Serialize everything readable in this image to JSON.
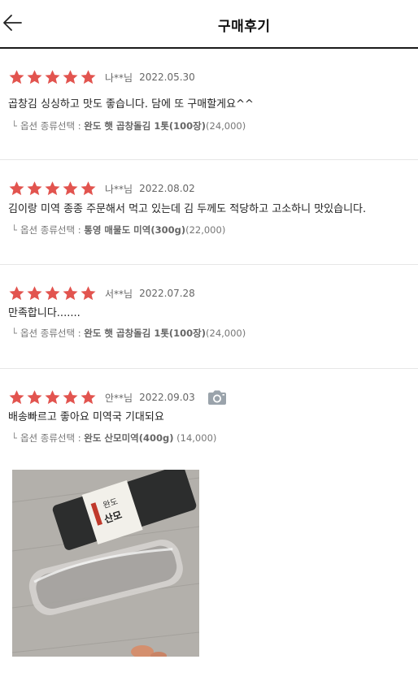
{
  "header": {
    "title": "구매후기"
  },
  "colors": {
    "star": "#e2544f",
    "camera": "#9aa3ab"
  },
  "option_label": "옵션 종류선택 : ",
  "reviews": [
    {
      "rating": 5,
      "user": "나**님",
      "date": "2022.05.30",
      "content": "곱창김 싱싱하고 맛도 좋습니다. 담에 또 구매할게요^^",
      "option_name": "완도 햇 곱창돌김 1톳(100장)",
      "option_price": "(24,000)",
      "has_photo": false
    },
    {
      "rating": 5,
      "user": "나**님",
      "date": "2022.08.02",
      "content": "김이랑 미역 종종 주문해서 먹고 있는데 김 두께도 적당하고 고소하니 맛있습니다.",
      "option_name": "통영 매물도 미역(300g)",
      "option_price": "(22,000)",
      "has_photo": false
    },
    {
      "rating": 5,
      "user": "서**님",
      "date": "2022.07.28",
      "content": "만족합니다.......",
      "option_name": "완도 햇 곱창돌김 1톳(100장)",
      "option_price": "(24,000)",
      "has_photo": false
    },
    {
      "rating": 5,
      "user": "안**님",
      "date": "2022.09.03",
      "content": "배송빠르고 좋아요 미역국  기대되요",
      "option_name": "완도 산모미역(400g)",
      "option_price": " (14,000)",
      "has_photo": true,
      "photo_icon": "camera-icon"
    }
  ]
}
